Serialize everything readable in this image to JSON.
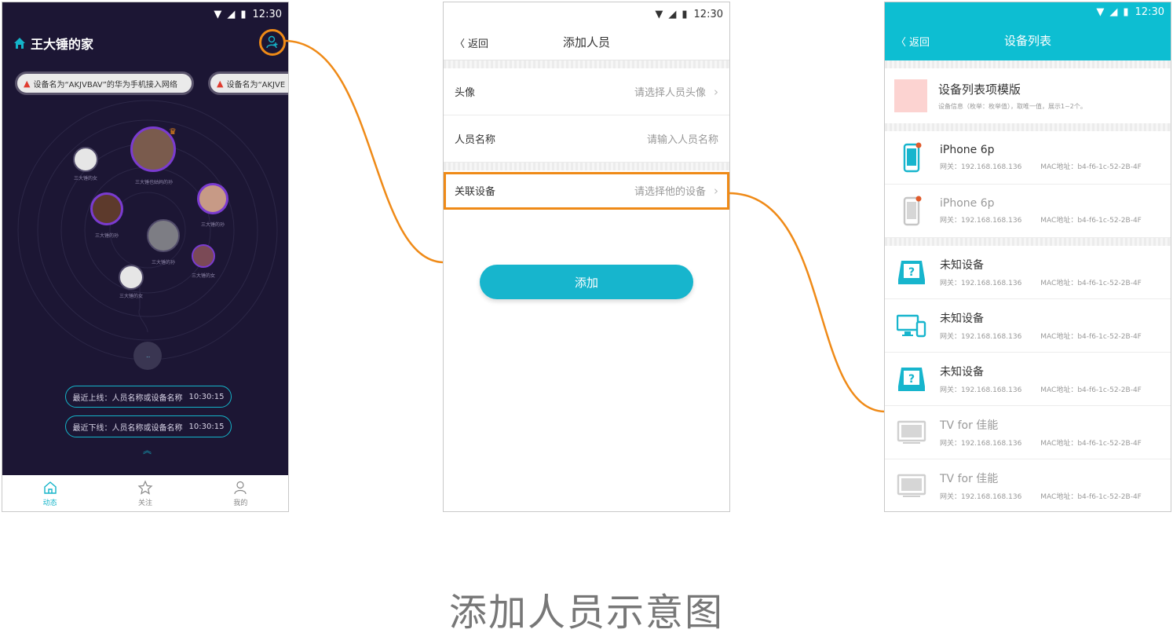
{
  "status_time": "12:30",
  "home": {
    "title": "王大锤的家",
    "alerts": [
      "设备名为“AKJVBAV”的华为手机接入网络",
      "设备名为“AKJVE"
    ],
    "avatar_labels": [
      "三大锤的女",
      "三大锤也姑妈的孙",
      "三大锤的孙",
      "三大锤的孙",
      "三大锤的孙",
      "三大锤的女",
      "三大锤的女"
    ],
    "events": [
      {
        "label": "最近上线：人员名称或设备名称",
        "time": "10:30:15"
      },
      {
        "label": "最近下线：人员名称或设备名称",
        "time": "10:30:15"
      }
    ],
    "nav": [
      "动态",
      "关注",
      "我的"
    ]
  },
  "add_person": {
    "back": "返回",
    "title": "添加人员",
    "rows": [
      {
        "label": "头像",
        "placeholder": "请选择人员头像"
      },
      {
        "label": "人员名称",
        "placeholder": "请输入人员名称"
      },
      {
        "label": "关联设备",
        "placeholder": "请选择他的设备"
      }
    ],
    "submit": "添加"
  },
  "device_list": {
    "back": "返回",
    "title": "设备列表",
    "template": {
      "title": "设备列表项模版",
      "sub": "设备信息（枚举：枚举值），取唯一值，展示1~2个。"
    },
    "devices": [
      {
        "name": "iPhone 6p",
        "gateway": "网关：192.168.168.136",
        "mac": "MAC地址：b4-f6-1c-52-2B-4F",
        "icon": "phone-icon",
        "online": true
      },
      {
        "name": "iPhone 6p",
        "gateway": "网关：192.168.168.136",
        "mac": "MAC地址：b4-f6-1c-52-2B-4F",
        "icon": "phone-icon",
        "online": false
      },
      {
        "name": "未知设备",
        "gateway": "网关：192.168.168.136",
        "mac": "MAC地址：b4-f6-1c-52-2B-4F",
        "icon": "unknown-device-icon",
        "online": true
      },
      {
        "name": "未知设备",
        "gateway": "网关：192.168.168.136",
        "mac": "MAC地址：b4-f6-1c-52-2B-4F",
        "icon": "desktop-icon",
        "online": true
      },
      {
        "name": "未知设备",
        "gateway": "网关：192.168.168.136",
        "mac": "MAC地址：b4-f6-1c-52-2B-4F",
        "icon": "unknown-device-icon",
        "online": true
      },
      {
        "name": "TV for 佳能",
        "gateway": "网关：192.168.168.136",
        "mac": "MAC地址：b4-f6-1c-52-2B-4F",
        "icon": "tv-icon",
        "online": false
      },
      {
        "name": "TV for 佳能",
        "gateway": "网关：192.168.168.136",
        "mac": "MAC地址：b4-f6-1c-52-2B-4F",
        "icon": "tv-icon",
        "online": false
      }
    ]
  },
  "caption": "添加人员示意图",
  "colors": {
    "accent": "#0dbed2",
    "highlight": "#ef8a17",
    "home_bg": "#1c1634",
    "alert_red": "#e03c2f"
  }
}
